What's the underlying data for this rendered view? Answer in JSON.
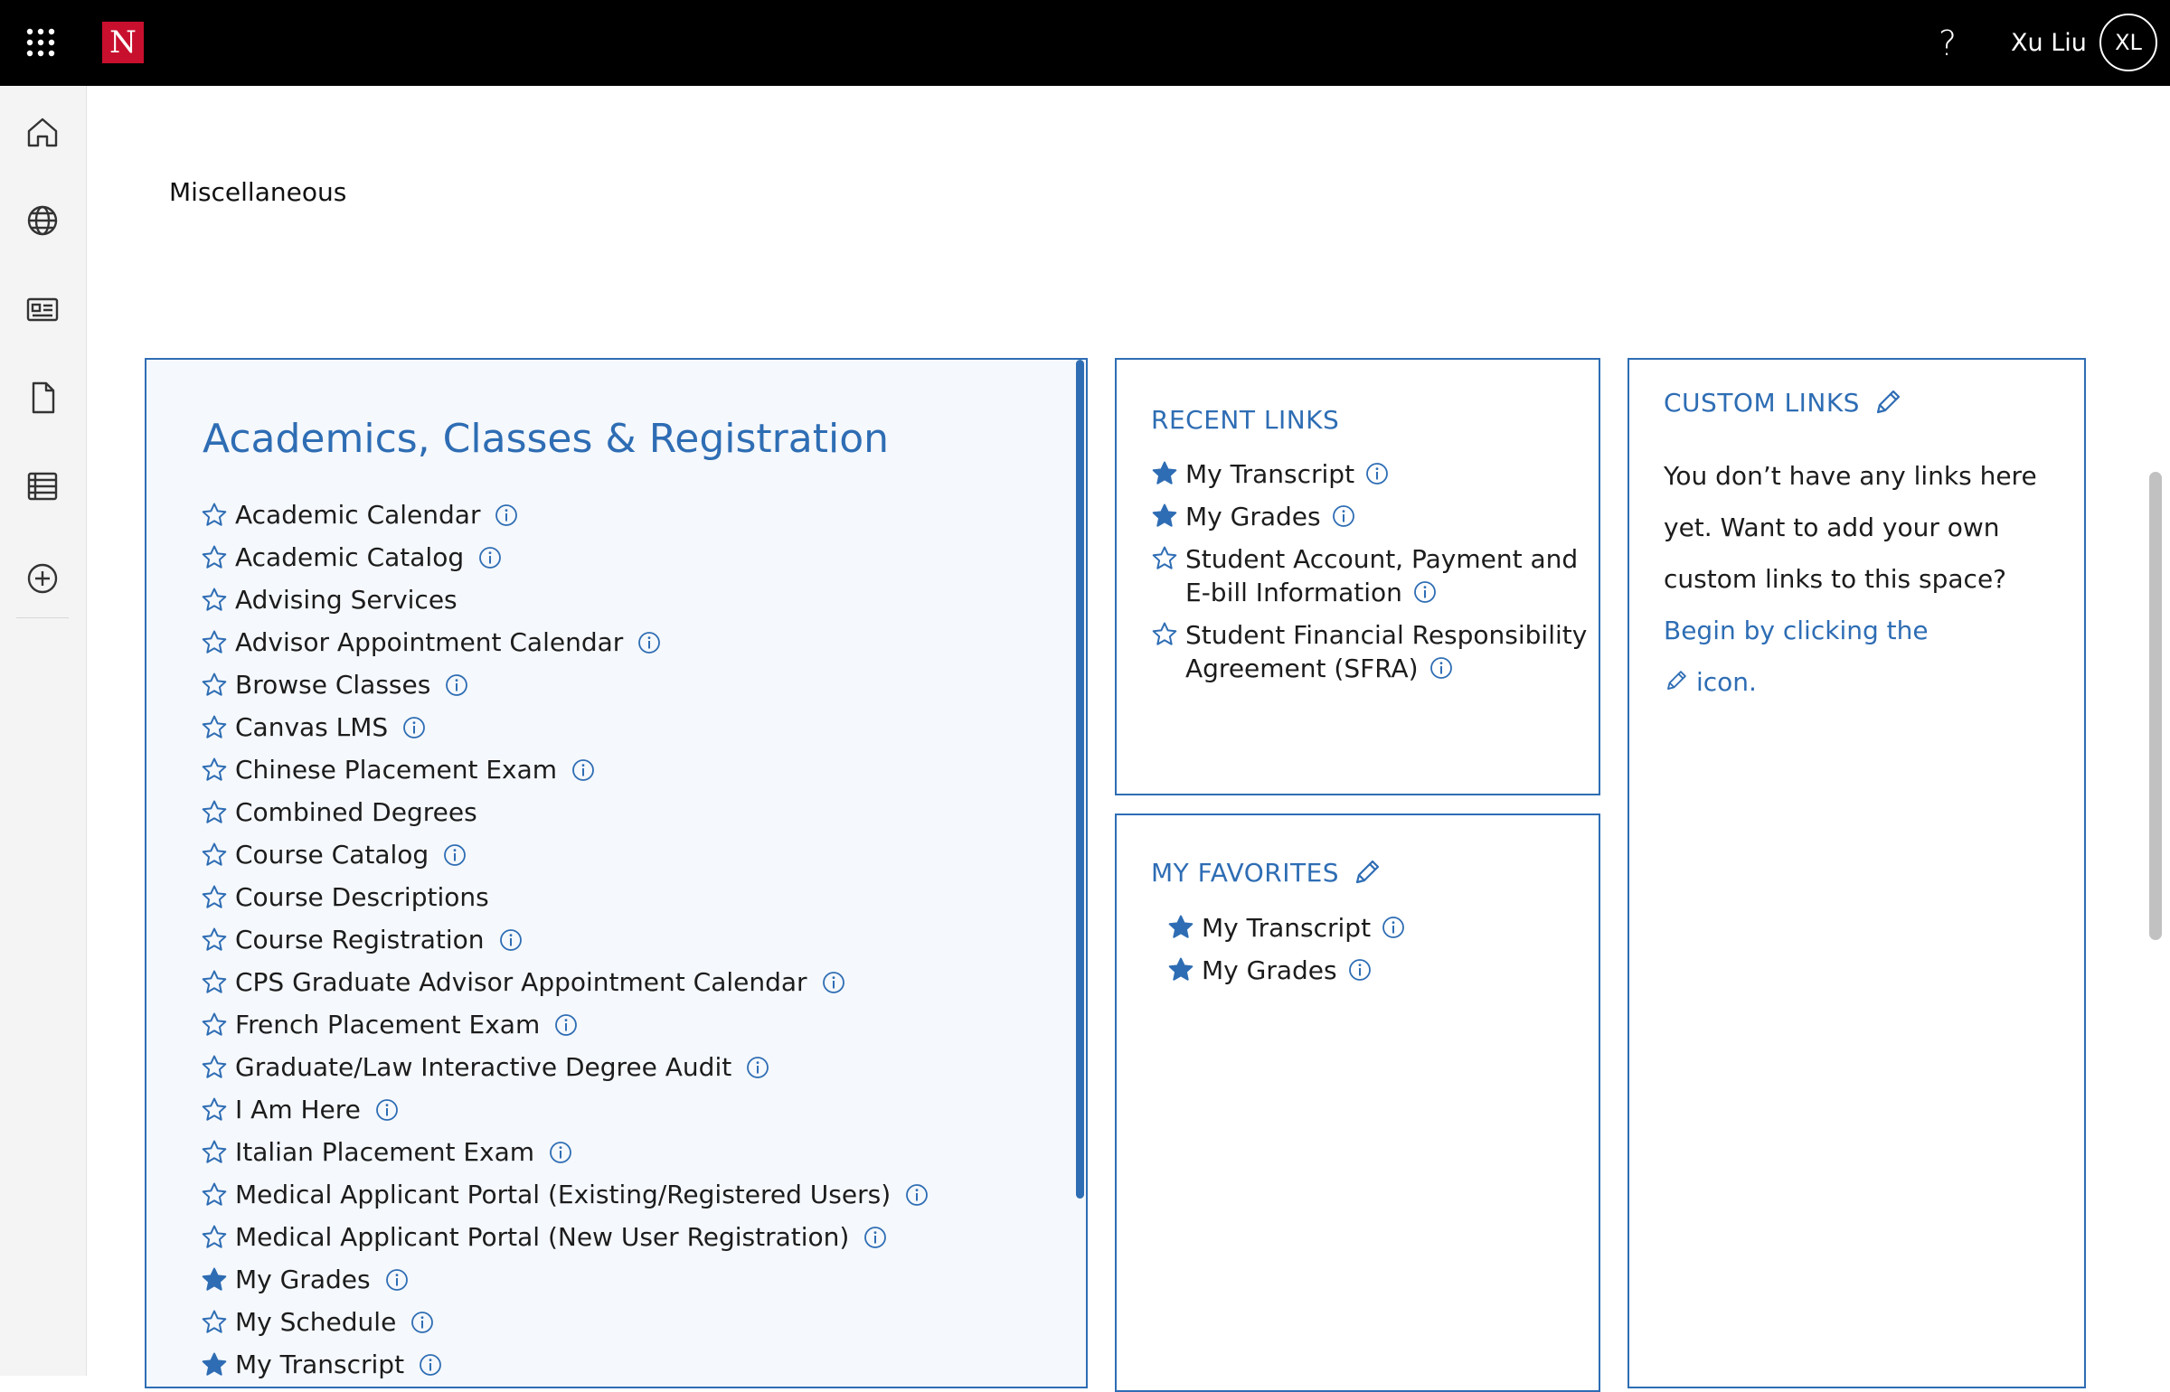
{
  "topbar": {
    "logo_letter": "N",
    "help_glyph": "?",
    "user_name": "Xu Liu",
    "user_initials": "XL",
    "icons": [
      "apps-grid-icon",
      "help-icon"
    ]
  },
  "sidebar": {
    "items": [
      {
        "name": "home-icon"
      },
      {
        "name": "globe-icon"
      },
      {
        "name": "news-icon"
      },
      {
        "name": "document-icon"
      },
      {
        "name": "table-icon"
      },
      {
        "name": "add-circle-icon"
      }
    ]
  },
  "page": {
    "category": "Miscellaneous"
  },
  "academics": {
    "title": "Academics, Classes & Registration",
    "links": [
      {
        "label": "Academic Calendar",
        "favorite": false,
        "info": true
      },
      {
        "label": "Academic Catalog",
        "favorite": false,
        "info": true
      },
      {
        "label": "Advising Services",
        "favorite": false,
        "info": false
      },
      {
        "label": "Advisor Appointment Calendar",
        "favorite": false,
        "info": true
      },
      {
        "label": "Browse Classes",
        "favorite": false,
        "info": true
      },
      {
        "label": "Canvas LMS",
        "favorite": false,
        "info": true
      },
      {
        "label": "Chinese Placement Exam",
        "favorite": false,
        "info": true
      },
      {
        "label": "Combined Degrees",
        "favorite": false,
        "info": false
      },
      {
        "label": "Course Catalog",
        "favorite": false,
        "info": true
      },
      {
        "label": "Course Descriptions",
        "favorite": false,
        "info": false
      },
      {
        "label": "Course Registration",
        "favorite": false,
        "info": true
      },
      {
        "label": "CPS Graduate Advisor Appointment Calendar",
        "favorite": false,
        "info": true
      },
      {
        "label": "French Placement Exam",
        "favorite": false,
        "info": true
      },
      {
        "label": "Graduate/Law Interactive Degree Audit",
        "favorite": false,
        "info": true
      },
      {
        "label": "I Am Here",
        "favorite": false,
        "info": true
      },
      {
        "label": "Italian Placement Exam",
        "favorite": false,
        "info": true
      },
      {
        "label": "Medical Applicant Portal (Existing/Registered Users)",
        "favorite": false,
        "info": true
      },
      {
        "label": "Medical Applicant Portal (New User Registration)",
        "favorite": false,
        "info": true
      },
      {
        "label": "My Grades",
        "favorite": true,
        "info": true
      },
      {
        "label": "My Schedule",
        "favorite": false,
        "info": true
      },
      {
        "label": "My Transcript",
        "favorite": true,
        "info": true
      }
    ]
  },
  "recent_links": {
    "title": "RECENT LINKS",
    "items": [
      {
        "label": "My Transcript",
        "favorite": true
      },
      {
        "label": "My Grades",
        "favorite": true
      },
      {
        "label": "Student Account, Payment and E-bill Information",
        "favorite": false
      },
      {
        "label": "Student Financial Responsibility Agreement (SFRA)",
        "favorite": false
      }
    ]
  },
  "my_favorites": {
    "title": "MY FAVORITES",
    "items": [
      {
        "label": "My Transcript",
        "favorite": true
      },
      {
        "label": "My Grades",
        "favorite": true
      }
    ]
  },
  "custom_links": {
    "title": "CUSTOM LINKS",
    "empty_text": "You don’t have any links here yet. Want to add your own custom links to this space?",
    "cta_text": "Begin by clicking the",
    "cta_suffix": "icon."
  },
  "colors": {
    "accent": "#2e6db4",
    "topbar": "#000000",
    "logo": "#c8102e",
    "rail": "#f4f4f4",
    "card_bg": "#f5f8fc"
  }
}
